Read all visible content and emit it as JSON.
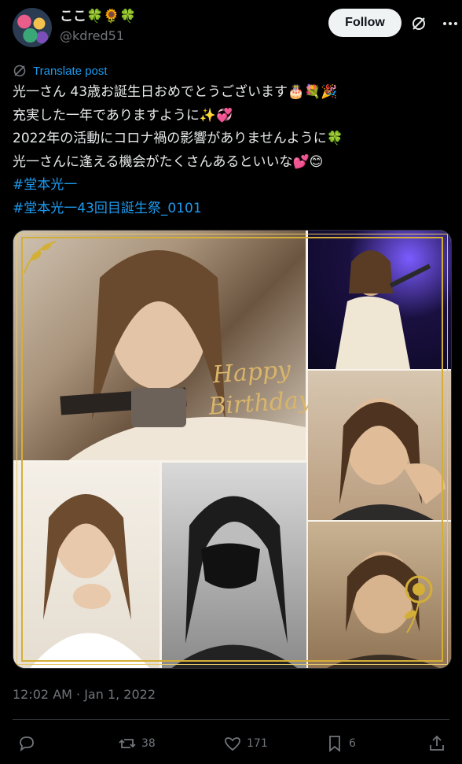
{
  "author": {
    "display_name": "ここ🍀🌻🍀",
    "handle": "@kdred51"
  },
  "follow_label": "Follow",
  "translate_label": "Translate post",
  "text_lines": [
    "光一さん 43歳お誕生日おめでとうございます🎂💐🎉",
    "充実した一年でありますように✨💞",
    "2022年の活動にコロナ禍の影響がありませんように🍀",
    "光一さんに逢える機会がたくさんあるといいな💕😊"
  ],
  "hashtags": [
    "#堂本光一",
    "#堂本光一43回目誕生祭_0101"
  ],
  "media": {
    "overlay_text_1": "Happy",
    "overlay_text_2": "Birthday"
  },
  "timestamp": "12:02 AM · Jan 1, 2022",
  "stats": {
    "reposts": "38",
    "likes": "171",
    "bookmarks": "6"
  },
  "colors": {
    "link": "#1d9bf0",
    "text": "#e7e9ea",
    "muted": "#71767b",
    "gold": "#d4af37"
  }
}
